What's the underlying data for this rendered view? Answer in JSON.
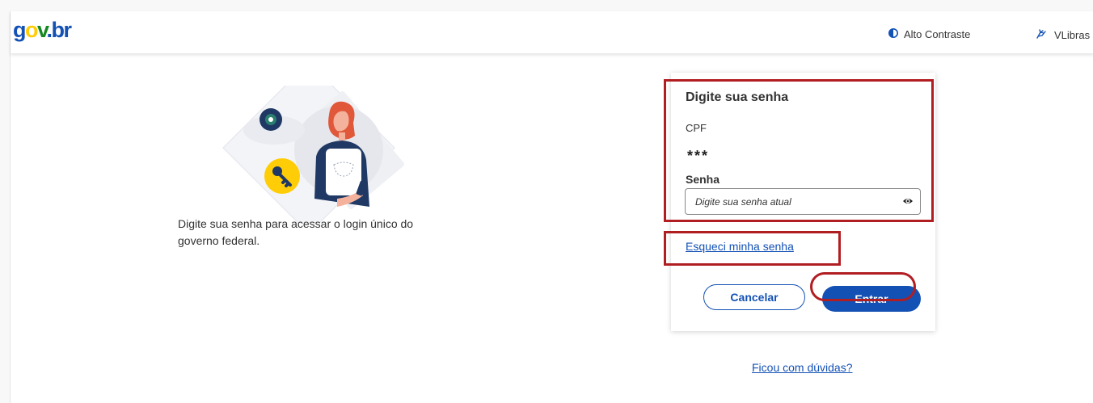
{
  "header": {
    "logo": {
      "g": "g",
      "o": "o",
      "v": "v",
      "dot": ".",
      "b": "b",
      "r": "r"
    },
    "contrast_label": "Alto Contraste",
    "vlibras_label": "VLibras"
  },
  "intro": {
    "description": "Digite sua senha para acessar o login único do governo federal."
  },
  "login": {
    "title": "Digite sua senha",
    "cpf_label": "CPF",
    "cpf_value": "***",
    "password_label": "Senha",
    "password_placeholder": "Digite sua senha atual",
    "password_value": "",
    "forgot_link": "Esqueci minha senha",
    "cancel_button": "Cancelar",
    "enter_button": "Entrar"
  },
  "footer": {
    "help_link": "Ficou com dúvidas?"
  },
  "colors": {
    "brand_blue": "#1351b4",
    "brand_yellow": "#ffcd07",
    "brand_green": "#168821",
    "highlight_red": "#b11e22"
  },
  "icons": {
    "contrast": "half-circle-contrast-icon",
    "vlibras": "hands-sign-language-icon",
    "password_visibility": "eye-icon"
  }
}
